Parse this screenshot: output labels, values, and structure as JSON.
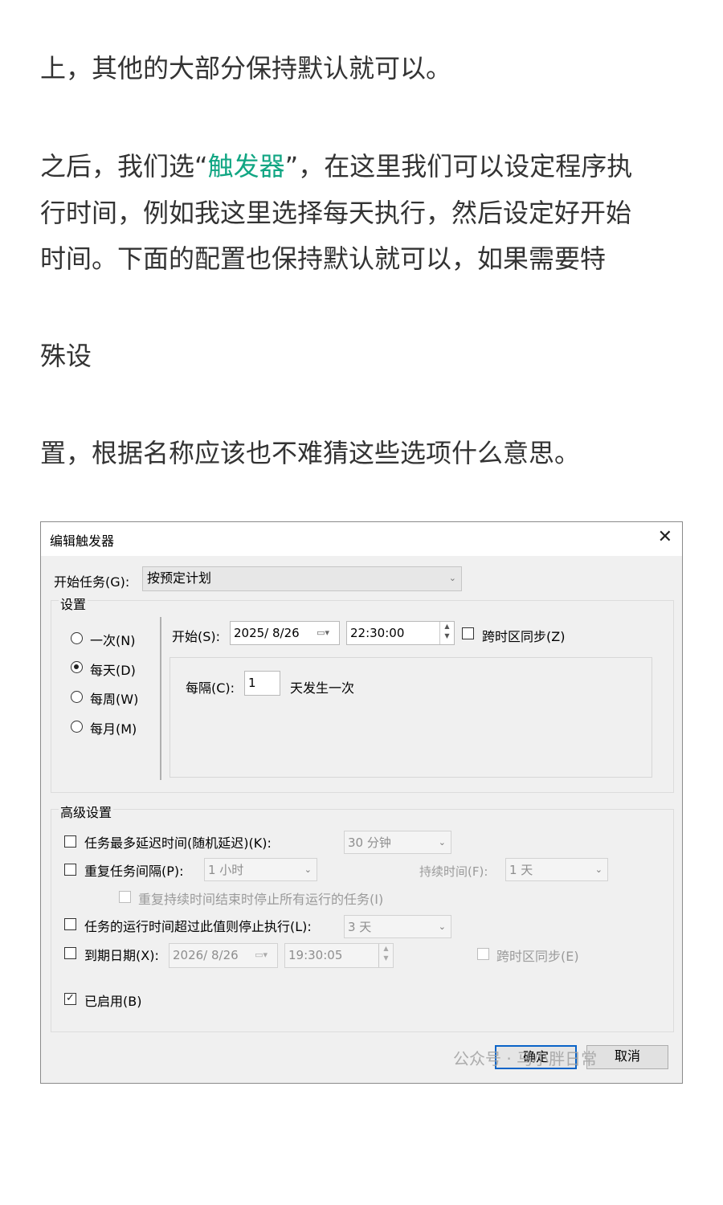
{
  "article": {
    "line1": "上，其他的大部分保持默认就可以。",
    "line2_pre": "之后，我们选“",
    "line2_hl": "触发器",
    "line2_post": "”，在这里我们可以设定程序执",
    "line3": "行时间，例如我这里选择每天执行，然后设定好开始",
    "line4": "时间。下面的配置也保持默认就可以，如果需要特",
    "line5": "殊设",
    "line6": "置，根据名称应该也不难猜这些选项什么意思。"
  },
  "dialog": {
    "title": "编辑触发器",
    "close_glyph": "✕",
    "start_task_label": "开始任务(G):",
    "start_task_value": "按预定计划",
    "settings_title": "设置",
    "schedule_options": [
      {
        "label": "一次(N)",
        "selected": false
      },
      {
        "label": "每天(D)",
        "selected": true
      },
      {
        "label": "每周(W)",
        "selected": false
      },
      {
        "label": "每月(M)",
        "selected": false
      }
    ],
    "start_label": "开始(S):",
    "start_date": "2025/  8/26",
    "start_time": "22:30:00",
    "sync_tz_label": "跨时区同步(Z)",
    "recur_label": "每隔(C):",
    "recur_value": "1",
    "recur_unit": "天发生一次",
    "advanced_title": "高级设置",
    "delay_label": "任务最多延迟时间(随机延迟)(K):",
    "delay_value": "30 分钟",
    "repeat_label": "重复任务间隔(P):",
    "repeat_value": "1 小时",
    "duration_label": "持续时间(F):",
    "duration_value": "1 天",
    "stop_all_label": "重复持续时间结束时停止所有运行的任务(I)",
    "stop_exceed_label": "任务的运行时间超过此值则停止执行(L):",
    "stop_exceed_value": "3 天",
    "expire_label": "到期日期(X):",
    "expire_date": "2026/  8/26",
    "expire_time": "19:30:05",
    "expire_sync_label": "跨时区同步(E)",
    "enabled_label": "已启用(B)",
    "enabled_checked": true,
    "ok_label": "确定",
    "cancel_label": "取消",
    "watermark": "公众号 · 马小胖日常"
  },
  "colors": {
    "highlight": "#11a683",
    "focus_border": "#0a64c8"
  }
}
